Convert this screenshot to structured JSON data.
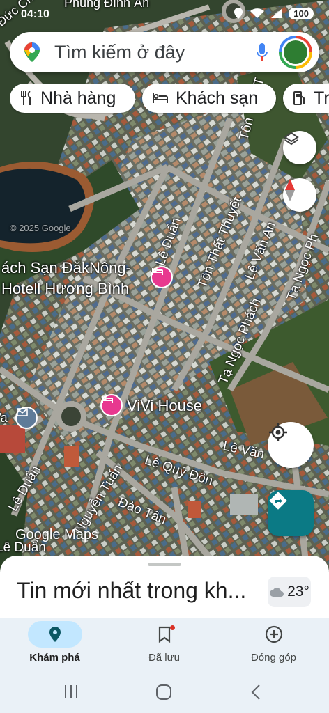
{
  "status_bar": {
    "time": "04:10",
    "battery": "100"
  },
  "search": {
    "placeholder": "Tìm kiếm ở đây"
  },
  "chips": [
    {
      "label": "Nhà hàng",
      "icon": "fork-knife-icon"
    },
    {
      "label": "Khách sạn",
      "icon": "bed-icon"
    },
    {
      "label": "Tra",
      "icon": "gas-station-icon"
    }
  ],
  "map": {
    "places": [
      {
        "name_line1": "ách Sạn ĐăkNông-",
        "name_line2": "Hotell Hương Bình",
        "icon": "hotel-pin-icon"
      },
      {
        "name": "ViVi House",
        "icon": "hotel-pin-icon"
      }
    ],
    "roads": [
      "Lê Duẩn",
      "Tôn Thất Thuyết",
      "Lê Văn An",
      "Tạ Ngọc Phách",
      "Tạ Ngọc Ph",
      "Tôn Thất T",
      "Lê Văn",
      "Lê Quý Đôn",
      "Nguyễn Tuấn",
      "Đào Tấn",
      "Lê Duẩn",
      "Lê Duẩn"
    ],
    "partial_labels": [
      "Phùng Đình Ân",
      "Đức Ch",
      "Tôn Thất",
      "Va"
    ],
    "watermark": "© 2025 Google",
    "attribution": "Google Maps",
    "controls": [
      "layers-icon",
      "compass-icon",
      "my-location-icon",
      "directions-icon"
    ]
  },
  "sheet": {
    "headline": "Tin mới nhất trong kh...",
    "weather_temp": "23°",
    "weather_icon": "cloud-moon-icon"
  },
  "bottom_nav": [
    {
      "label": "Khám phá",
      "icon": "explore-pin-icon",
      "active": true
    },
    {
      "label": "Đã lưu",
      "icon": "bookmark-icon",
      "active": false
    },
    {
      "label": "Đóng góp",
      "icon": "add-circle-icon",
      "active": false
    }
  ],
  "system_nav": [
    "recents-icon",
    "home-icon",
    "back-icon"
  ],
  "colors": {
    "accent": "#1a73e8",
    "nav_active": "#c2e7ff",
    "poi": "#e8388f",
    "directions_fab": "#0b7a85"
  }
}
